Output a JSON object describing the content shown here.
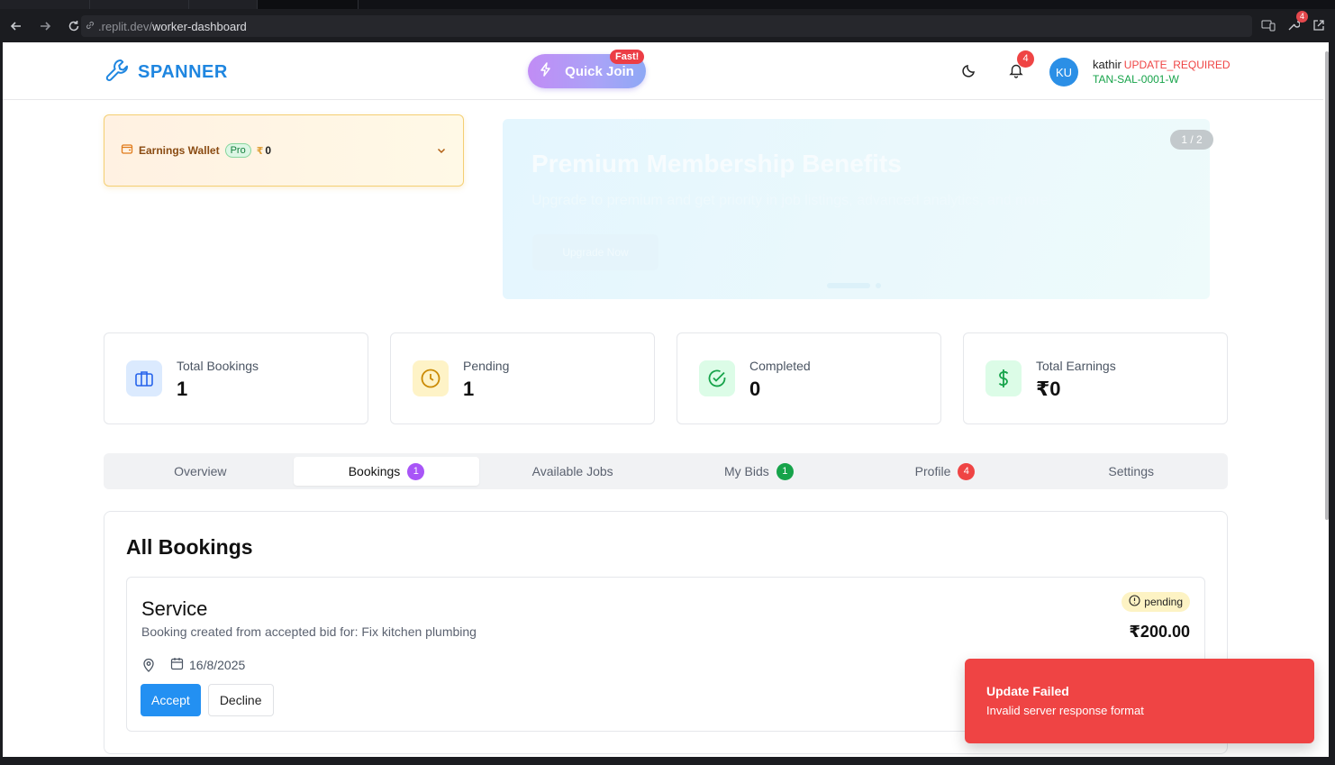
{
  "browser": {
    "url_prefix": ".replit.dev/",
    "url_path": "worker-dashboard",
    "extension_badge": "4"
  },
  "header": {
    "brand": "SPANNER",
    "quick_join_label": "Quick Join",
    "fast_badge": "Fast!",
    "notification_count": "4",
    "avatar_initials": "KU",
    "user_name": "kathir",
    "user_status": "UPDATE_REQUIRED",
    "worker_id": "TAN-SAL-0001-W"
  },
  "wallet": {
    "label": "Earnings Wallet",
    "tier": "Pro",
    "currency": "₹",
    "amount": "0"
  },
  "banner": {
    "title": "Premium Membership Benefits",
    "subtitle": "Upgrade to premium and get priority in job listings, advanced analytics, and more!",
    "button_label": "Upgrade Now",
    "counter": "1 / 2"
  },
  "stats": [
    {
      "label": "Total Bookings",
      "value": "1",
      "icon": "briefcase-icon",
      "bg": "#dbeafe",
      "color": "#2563eb"
    },
    {
      "label": "Pending",
      "value": "1",
      "icon": "clock-icon",
      "bg": "#fef3c7",
      "color": "#ca8a04"
    },
    {
      "label": "Completed",
      "value": "0",
      "icon": "check-circle-icon",
      "bg": "#dcfce7",
      "color": "#16a34a"
    },
    {
      "label": "Total Earnings",
      "value": "₹0",
      "icon": "dollar-icon",
      "bg": "#dcfce7",
      "color": "#16a34a"
    }
  ],
  "tabs": [
    {
      "label": "Overview",
      "badge": null
    },
    {
      "label": "Bookings",
      "badge": "1",
      "badge_color": "#a855f7"
    },
    {
      "label": "Available Jobs",
      "badge": null
    },
    {
      "label": "My Bids",
      "badge": "1",
      "badge_color": "#16a34a"
    },
    {
      "label": "Profile",
      "badge": "4",
      "badge_color": "#ef4444"
    },
    {
      "label": "Settings",
      "badge": null
    }
  ],
  "bookings": {
    "title": "All Bookings",
    "items": [
      {
        "service": "Service",
        "description": "Booking created from accepted bid for: Fix kitchen plumbing",
        "date": "16/8/2025",
        "status": "pending",
        "price": "₹200.00",
        "accept_label": "Accept",
        "decline_label": "Decline"
      }
    ]
  },
  "toast": {
    "title": "Update Failed",
    "message": "Invalid server response format"
  },
  "colors": {
    "brand": "#1f86e0",
    "error": "#ef4444",
    "accept": "#2390f2"
  }
}
